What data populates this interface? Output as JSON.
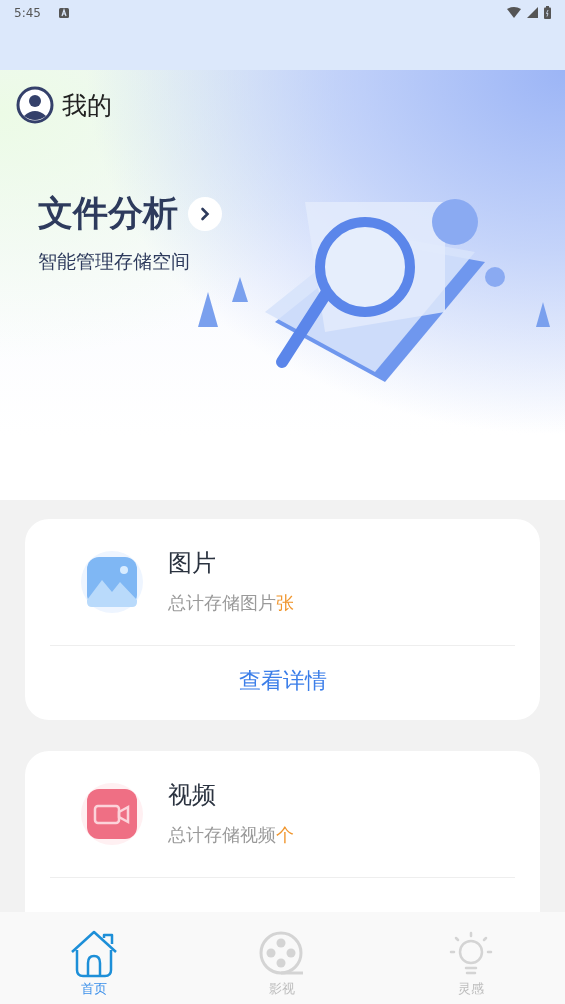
{
  "status_bar": {
    "time": "5:45"
  },
  "header": {
    "title": "我的"
  },
  "hero": {
    "title": "文件分析",
    "subtitle": "智能管理存储空间"
  },
  "cards": [
    {
      "kind": "image",
      "title": "图片",
      "summary": "总计存储图片",
      "unit": "张",
      "action": "查看详情"
    },
    {
      "kind": "video",
      "title": "视频",
      "summary": "总计存储视频",
      "unit": "个"
    }
  ],
  "bottom_nav": [
    {
      "kind": "home",
      "label": "首页",
      "selected": true
    },
    {
      "kind": "film",
      "label": "影视",
      "selected": false
    },
    {
      "kind": "idea",
      "label": "灵感",
      "selected": false
    }
  ]
}
